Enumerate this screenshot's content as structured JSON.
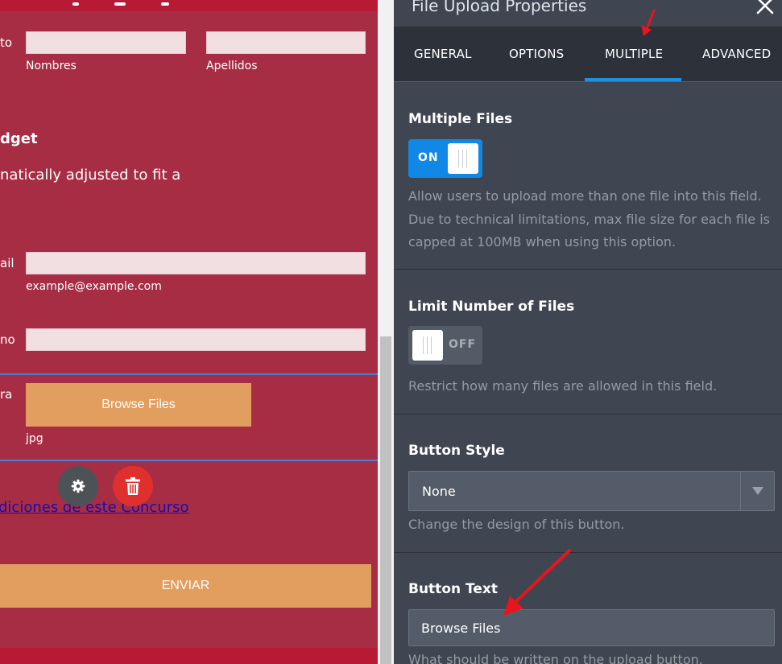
{
  "form": {
    "fields": {
      "name_label_fragment": "to",
      "first_name_sublabel": "Nombres",
      "last_name_sublabel": "Apellidos",
      "email_label_fragment": "ail",
      "email_sublabel": "example@example.com",
      "phone_label_fragment": "no",
      "upload_label_fragment": "ra",
      "upload_sublabel": "jpg"
    },
    "widget_heading_fragment": "dget",
    "widget_description_fragment": "natically adjusted to fit a",
    "browse_button_label": "Browse Files",
    "terms_link_text": "diciones de este Concurso",
    "submit_button_label": "ENVIAR"
  },
  "panel": {
    "title": "File Upload Properties",
    "tabs": [
      {
        "label": "GENERAL"
      },
      {
        "label": "OPTIONS"
      },
      {
        "label": "MULTIPLE",
        "active": true
      },
      {
        "label": "ADVANCED"
      }
    ],
    "multiple_files": {
      "title": "Multiple Files",
      "toggle_state": "ON",
      "description": "Allow users to upload more than one file into this field. Due to technical limitations, max file size for each file is capped at 100MB when using this option."
    },
    "limit_files": {
      "title": "Limit Number of Files",
      "toggle_state": "OFF",
      "description": "Restrict how many files are allowed in this field."
    },
    "button_style": {
      "title": "Button Style",
      "selected": "None",
      "description": "Change the design of this button."
    },
    "button_text": {
      "title": "Button Text",
      "value": "Browse Files",
      "description": "What should be written on the upload button."
    }
  },
  "colors": {
    "form_background": "#a72d45",
    "form_accent_strip": "#b81a35",
    "orange_button": "#e19e5e",
    "panel_background": "#3f4652",
    "tabbar_background": "#2c313a",
    "active_tab_accent": "#1d90e0",
    "toggle_on": "#1187e6",
    "annotation_arrow": "#e8141e"
  },
  "icons": [
    "gear-icon",
    "trash-icon",
    "close-icon",
    "dropdown-arrow-icon",
    "annotation-arrow"
  ]
}
